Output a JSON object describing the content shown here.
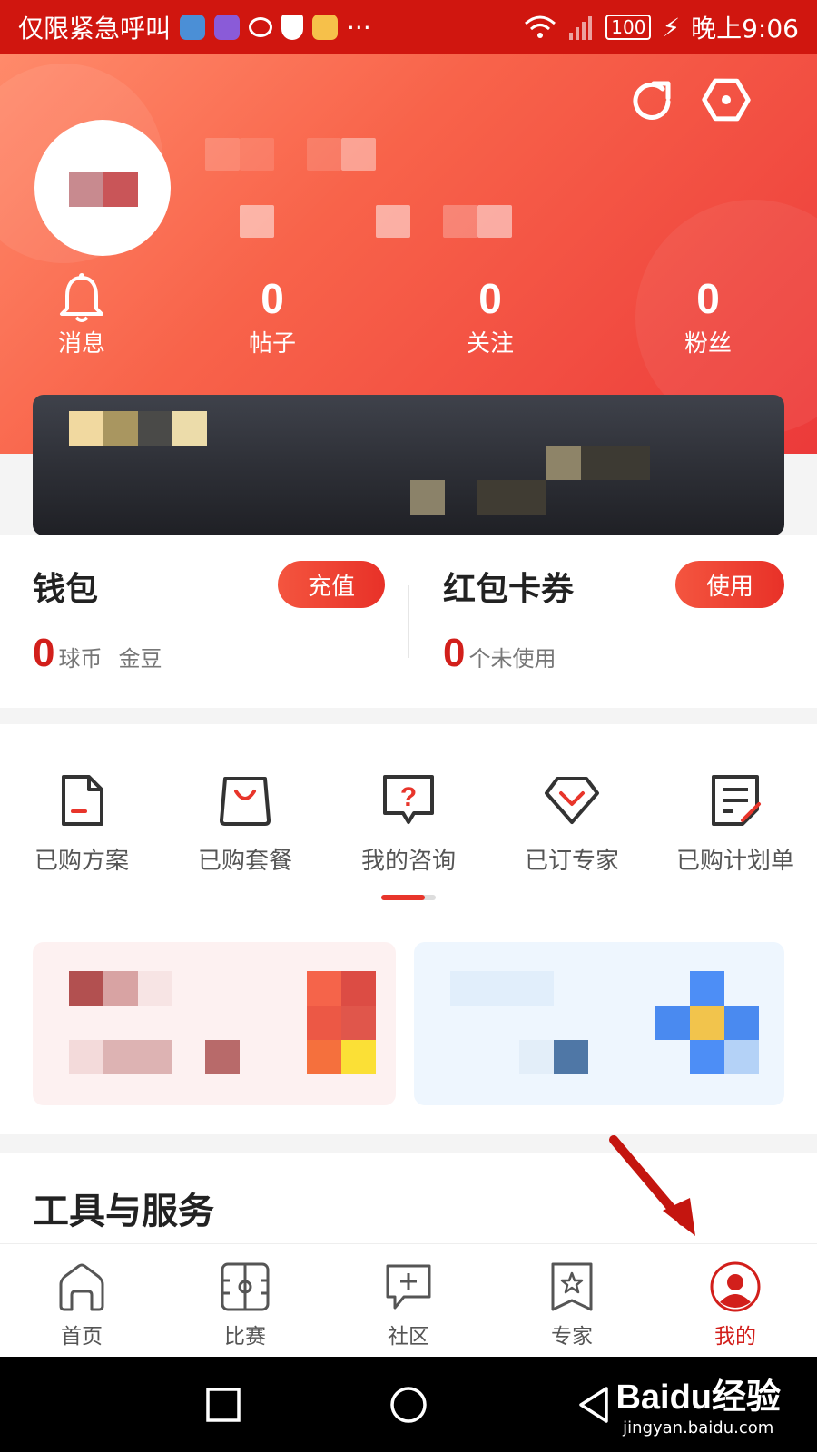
{
  "status_bar": {
    "carrier": "仅限紧急呼叫",
    "more": "···",
    "battery": "100",
    "time": "晚上9:06"
  },
  "profile": {
    "stats": [
      {
        "icon": "bell-icon",
        "label": "消息"
      },
      {
        "value": "0",
        "label": "帖子"
      },
      {
        "value": "0",
        "label": "关注"
      },
      {
        "value": "0",
        "label": "粉丝"
      }
    ]
  },
  "wallet": {
    "title": "钱包",
    "button": "充值",
    "count": "0",
    "unit1": "球币",
    "unit2": "金豆"
  },
  "coupons": {
    "title": "红包卡券",
    "button": "使用",
    "count": "0",
    "unit": "个未使用"
  },
  "menu": [
    {
      "icon": "document-icon",
      "label": "已购方案"
    },
    {
      "icon": "bag-icon",
      "label": "已购套餐"
    },
    {
      "icon": "question-bubble-icon",
      "label": "我的咨询"
    },
    {
      "icon": "diamond-check-icon",
      "label": "已订专家"
    },
    {
      "icon": "notes-icon",
      "label": "已购计划单"
    }
  ],
  "tools": {
    "title": "工具与服务"
  },
  "tabbar": [
    {
      "icon": "home-icon",
      "label": "首页"
    },
    {
      "icon": "field-icon",
      "label": "比赛"
    },
    {
      "icon": "chat-plus-icon",
      "label": "社区"
    },
    {
      "icon": "star-bookmark-icon",
      "label": "专家"
    },
    {
      "icon": "user-icon",
      "label": "我的",
      "active": true
    }
  ],
  "watermark": {
    "brand": "Baidu经验",
    "url": "jingyan.baidu.com"
  },
  "colors": {
    "status_bar": "#d0160f",
    "accent_red": "#e8352b",
    "banner_dark": "#2e3037"
  }
}
